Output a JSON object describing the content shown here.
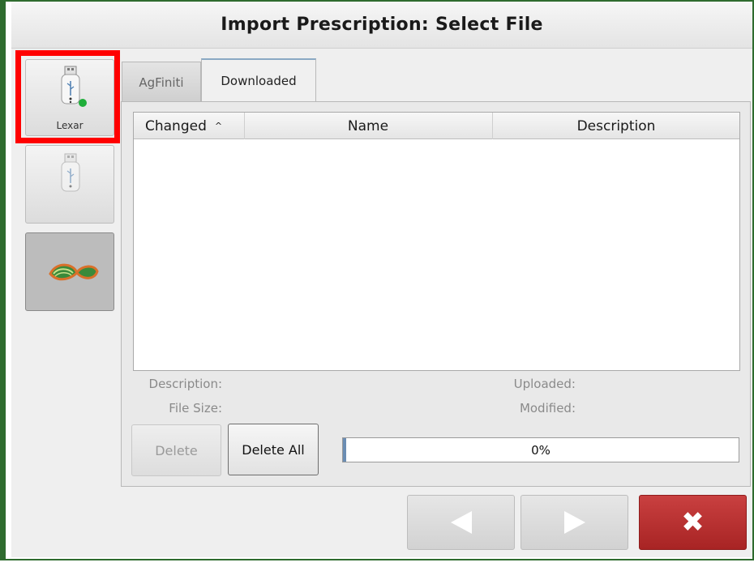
{
  "title": "Import Prescription: Select File",
  "devices": [
    {
      "label": "Lexar",
      "icon": "usb-drive-icon",
      "status": "connected",
      "selected": true
    },
    {
      "label": "",
      "icon": "usb-drive-icon"
    },
    {
      "label": "",
      "icon": "agfiniti-logo-icon"
    }
  ],
  "tabs": [
    {
      "label": "AgFiniti"
    },
    {
      "label": "Downloaded",
      "active": true
    }
  ],
  "table": {
    "columns": [
      "Changed",
      "Name",
      "Description"
    ],
    "sort_indicator": "^",
    "rows": []
  },
  "details": {
    "description_label": "Description:",
    "file_size_label": "File Size:",
    "uploaded_label": "Uploaded:",
    "modified_label": "Modified:"
  },
  "buttons": {
    "delete": "Delete",
    "delete_all": "Delete All"
  },
  "progress": {
    "value": 0,
    "text": "0%"
  },
  "colors": {
    "border_green": "#2e6b2e",
    "highlight_red": "#ff0000",
    "cancel_red": "#b52e2e",
    "status_green": "#1fae3a"
  }
}
